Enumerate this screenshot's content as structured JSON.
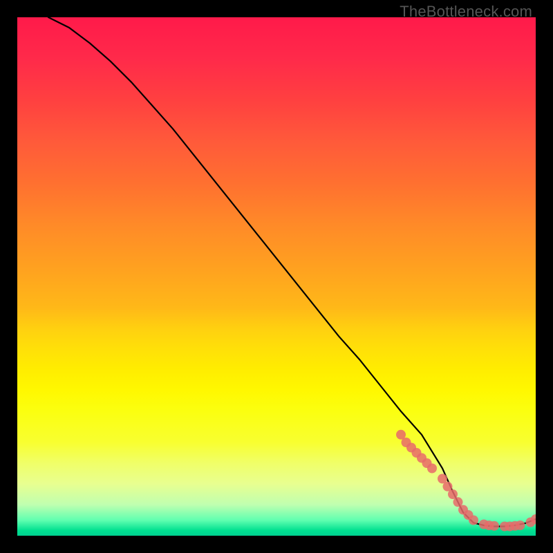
{
  "watermark": "TheBottleneck.com",
  "chart_data": {
    "type": "line",
    "title": "",
    "xlabel": "",
    "ylabel": "",
    "xlim": [
      0,
      100
    ],
    "ylim": [
      0,
      100
    ],
    "curve": {
      "x": [
        6,
        10,
        14,
        18,
        22,
        26,
        30,
        34,
        38,
        42,
        46,
        50,
        54,
        58,
        62,
        66,
        70,
        74,
        78,
        82,
        84,
        86,
        88,
        90,
        92,
        94,
        96,
        98,
        100
      ],
      "y": [
        100,
        98,
        95,
        91.5,
        87.5,
        83,
        78.5,
        73.5,
        68.5,
        63.5,
        58.5,
        53.5,
        48.5,
        43.5,
        38.5,
        34,
        29,
        24,
        19.5,
        13,
        8.5,
        4.5,
        2.5,
        2.0,
        1.8,
        1.8,
        2.0,
        2.4,
        3.2
      ]
    },
    "markers": {
      "x": [
        74,
        75,
        76,
        77,
        78,
        79,
        80,
        82,
        83,
        84,
        85,
        86,
        87,
        88,
        90,
        91,
        92,
        94,
        95,
        96,
        97,
        99,
        100
      ],
      "y": [
        19.5,
        18,
        17,
        16,
        15,
        14,
        13,
        11,
        9.5,
        8,
        6.5,
        5,
        4,
        3,
        2.2,
        2.0,
        1.9,
        1.8,
        1.8,
        1.9,
        2.0,
        2.6,
        3.2
      ]
    },
    "gradient_stops": [
      {
        "pos": 0,
        "color": "#ff1a4a"
      },
      {
        "pos": 50,
        "color": "#ffd010"
      },
      {
        "pos": 80,
        "color": "#f8ff30"
      },
      {
        "pos": 100,
        "color": "#00d090"
      }
    ]
  }
}
